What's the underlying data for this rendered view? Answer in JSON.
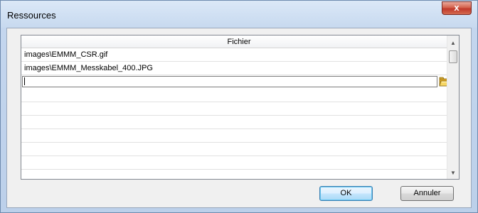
{
  "window": {
    "title": "Ressources",
    "close_glyph": "x"
  },
  "table": {
    "column_header": "Fichier",
    "rows": [
      "images\\EMMM_CSR.gif",
      "images\\EMMM_Messkabel_400.JPG"
    ],
    "edit_value": "",
    "browse_icon": "folder-open-icon"
  },
  "buttons": {
    "ok_label": "OK",
    "cancel_label": "Annuler"
  },
  "colors": {
    "title_bar": "#c7d9ef",
    "close_button": "#c0392b",
    "ok_button_accent": "#3c7fb1"
  }
}
